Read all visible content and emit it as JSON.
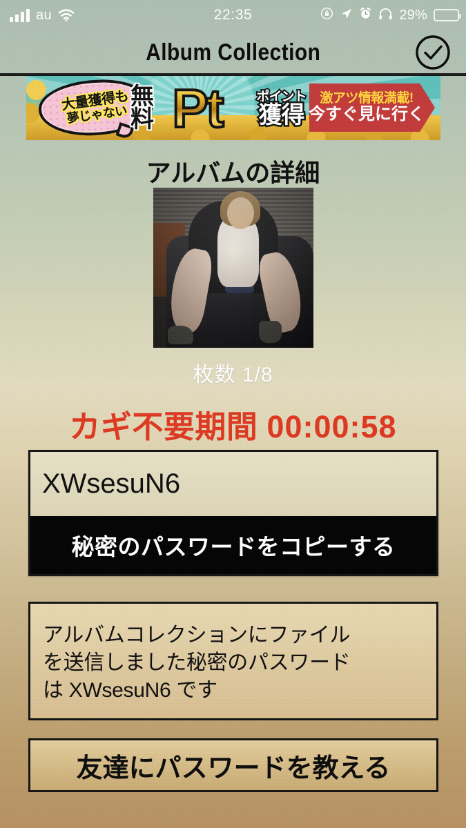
{
  "status_bar": {
    "signal_icon": "signal-bars-icon",
    "signal_bars": 4,
    "carrier": "au",
    "wifi_icon": "wifi-icon",
    "time": "22:35",
    "rotation_lock_icon": "rotation-lock-icon",
    "location_icon": "location-arrow-icon",
    "alarm_icon": "alarm-clock-icon",
    "headphones_icon": "headphones-icon",
    "battery_percent": "29%",
    "battery_level": 29,
    "battery_color": "#f5d33b"
  },
  "nav": {
    "title": "Album Collection",
    "confirm_icon": "check-circle-icon"
  },
  "banner": {
    "bubble_line1": "大量獲得も",
    "bubble_line2": "夢じゃない",
    "free_line1": "無",
    "free_line2": "料",
    "pt": "Pt",
    "point_label": "ポイント",
    "kakutoku_label": "獲得",
    "cta_line1": "激アツ情報満載!",
    "cta_line2": "今すぐ見に行く",
    "cta_color": "#c33b3b",
    "bg_color": "#5fc0ba",
    "bubble_color": "#f6c6d6"
  },
  "album": {
    "heading": "アルバムの詳細",
    "thumbnail_name": "album-thumbnail",
    "count_label": "枚数 1/8"
  },
  "timer": {
    "label": "カギ不要期間",
    "value": "00:00:58",
    "color": "#de3a22"
  },
  "password": {
    "value": "XWsesuN6",
    "copy_button_label": "秘密のパスワードをコピーする"
  },
  "message": {
    "line1": "アルバムコレクションにファイル",
    "line2": "を送信しました秘密のパスワード",
    "line3": "は XWsesuN6 です"
  },
  "share": {
    "button_label": "友達にパスワードを教える"
  }
}
